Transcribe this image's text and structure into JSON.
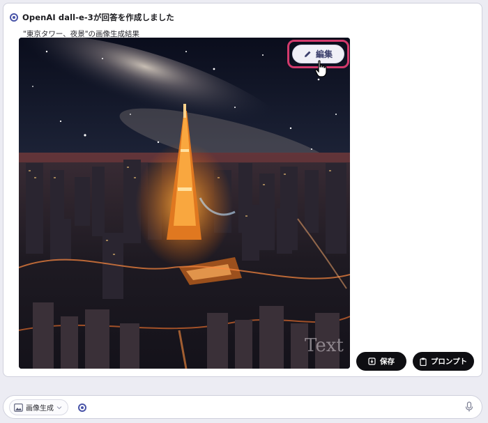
{
  "answer": {
    "model_icon": "model-radio-icon",
    "title": "OpenAI dall-e-3が回答を作成しました",
    "prompt_caption": "\"東京タワー、夜景\"の画像生成結果",
    "image_watermark": "Text"
  },
  "image_toolbar": {
    "edit_label": "編集",
    "edit_icon": "pencil-icon",
    "highlight_color": "#d23a6c"
  },
  "actions": {
    "save_label": "保存",
    "save_icon": "save-icon",
    "prompt_label": "プロンプト",
    "prompt_icon": "clipboard-icon"
  },
  "composer": {
    "mode_label": "画像生成",
    "mode_icon": "image-icon",
    "mic_icon": "microphone-icon",
    "accent_color": "#4a55a8"
  }
}
